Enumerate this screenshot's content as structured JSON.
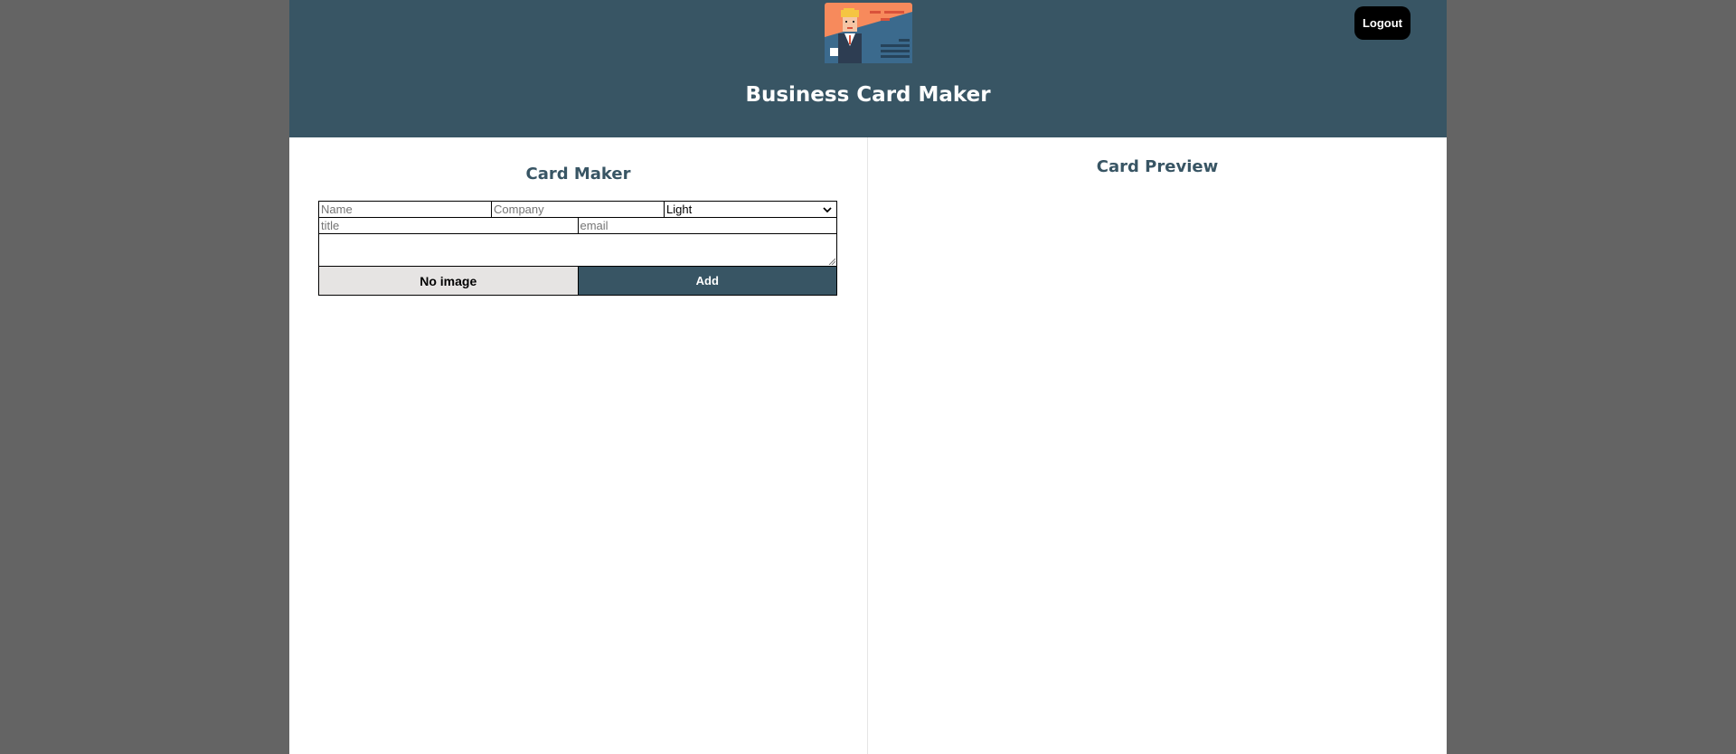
{
  "header": {
    "logo_icon": "business-card-logo-icon",
    "title": "Business Card Maker",
    "logout_label": "Logout"
  },
  "maker": {
    "title": "Card Maker",
    "form": {
      "name_placeholder": "Name",
      "company_placeholder": "Company",
      "theme_value": "Light",
      "title_placeholder": "title",
      "email_placeholder": "email",
      "message_value": "",
      "image_button_label": "No image",
      "add_button_label": "Add"
    }
  },
  "preview": {
    "title": "Card Preview"
  },
  "colors": {
    "brand": "#385564",
    "background": "#646464",
    "image_button_bg": "#e6e4e3",
    "logout_bg": "#000000"
  }
}
